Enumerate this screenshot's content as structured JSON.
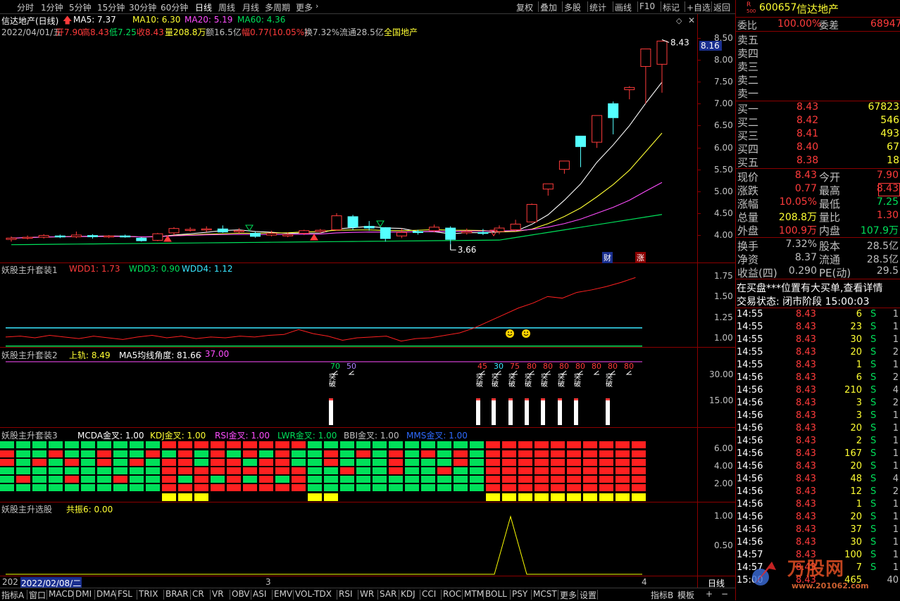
{
  "toolbar": {
    "periods": [
      "分时",
      "1分钟",
      "5分钟",
      "15分钟",
      "30分钟",
      "60分钟",
      "日线",
      "周线",
      "月线",
      "多周期",
      "更多"
    ],
    "active_period": "日线",
    "right_items": [
      "复权",
      "叠加",
      "多股",
      "统计",
      "画线",
      "F10",
      "标记",
      "+自选",
      "返回"
    ]
  },
  "main_chart": {
    "title": "信达地产(日线)",
    "ma5": "MA5: 7.37",
    "ma10": "MA10: 6.30",
    "ma20": "MA20: 5.19",
    "ma60": "MA60: 4.36",
    "info_date": "2022/04/01/五",
    "info_open": "开7.90",
    "info_high": "高8.43",
    "info_low": "低7.25",
    "info_close": "收8.43",
    "info_vol": "量208.8万",
    "info_amt": "额16.5亿",
    "info_pct": "幅0.77(10.05%)",
    "info_turn": "换7.32%",
    "info_float": "流通28.5亿",
    "info_sector": "全国地产",
    "current_price_tag": "8.16",
    "high_label": "8.43",
    "low_label": "3.66",
    "badge_cai": "财",
    "badge_zhang": "涨",
    "y_ticks": [
      "8.50",
      "8.00",
      "7.50",
      "7.00",
      "6.50",
      "6.00",
      "5.50",
      "5.00",
      "4.50",
      "4.00"
    ],
    "candles": [
      {
        "o": 3.9,
        "c": 3.93,
        "h": 3.97,
        "l": 3.85
      },
      {
        "o": 3.94,
        "c": 3.95,
        "h": 3.99,
        "l": 3.9
      },
      {
        "o": 3.95,
        "c": 3.99,
        "h": 4.02,
        "l": 3.92
      },
      {
        "o": 3.98,
        "c": 3.97,
        "h": 4.01,
        "l": 3.93
      },
      {
        "o": 3.96,
        "c": 4.0,
        "h": 4.08,
        "l": 3.93
      },
      {
        "o": 3.99,
        "c": 3.96,
        "h": 4.02,
        "l": 3.92
      },
      {
        "o": 3.96,
        "c": 3.98,
        "h": 4.0,
        "l": 3.93
      },
      {
        "o": 3.98,
        "c": 3.97,
        "h": 4.01,
        "l": 3.94
      },
      {
        "o": 3.93,
        "c": 3.87,
        "h": 3.95,
        "l": 3.85
      },
      {
        "o": 3.88,
        "c": 4.03,
        "h": 4.05,
        "l": 3.86
      },
      {
        "o": 4.05,
        "c": 4.15,
        "h": 4.18,
        "l": 4.0
      },
      {
        "o": 4.12,
        "c": 4.13,
        "h": 4.18,
        "l": 4.08
      },
      {
        "o": 4.12,
        "c": 4.14,
        "h": 4.2,
        "l": 4.07
      },
      {
        "o": 4.14,
        "c": 4.07,
        "h": 4.22,
        "l": 4.05
      },
      {
        "o": 4.09,
        "c": 4.1,
        "h": 4.16,
        "l": 4.04
      },
      {
        "o": 4.04,
        "c": 3.97,
        "h": 4.08,
        "l": 3.94
      },
      {
        "o": 4.0,
        "c": 4.04,
        "h": 4.1,
        "l": 3.97
      },
      {
        "o": 3.98,
        "c": 4.01,
        "h": 4.06,
        "l": 3.95
      },
      {
        "o": 4.04,
        "c": 4.1,
        "h": 4.12,
        "l": 4.0
      },
      {
        "o": 4.08,
        "c": 4.11,
        "h": 4.14,
        "l": 4.04
      },
      {
        "o": 4.12,
        "c": 4.44,
        "h": 4.5,
        "l": 4.1
      },
      {
        "o": 4.42,
        "c": 4.18,
        "h": 4.46,
        "l": 4.12
      },
      {
        "o": 4.2,
        "c": 4.16,
        "h": 4.32,
        "l": 4.1
      },
      {
        "o": 4.17,
        "c": 3.92,
        "h": 4.18,
        "l": 3.85
      },
      {
        "o": 3.98,
        "c": 4.06,
        "h": 4.15,
        "l": 3.93
      },
      {
        "o": 4.08,
        "c": 4.07,
        "h": 4.12,
        "l": 4.01
      },
      {
        "o": 4.1,
        "c": 4.18,
        "h": 4.24,
        "l": 4.06
      },
      {
        "o": 4.16,
        "c": 3.9,
        "h": 4.2,
        "l": 3.66
      },
      {
        "o": 4.05,
        "c": 4.08,
        "h": 4.15,
        "l": 4.01
      },
      {
        "o": 4.06,
        "c": 4.04,
        "h": 4.14,
        "l": 4.0
      },
      {
        "o": 4.08,
        "c": 4.16,
        "h": 4.22,
        "l": 4.02
      },
      {
        "o": 4.12,
        "c": 4.25,
        "h": 4.35,
        "l": 4.08
      },
      {
        "o": 4.3,
        "c": 4.7,
        "h": 4.72,
        "l": 4.28
      },
      {
        "o": 5.05,
        "c": 5.17,
        "h": 5.17,
        "l": 4.9
      },
      {
        "o": 5.5,
        "c": 5.69,
        "h": 5.69,
        "l": 5.4
      },
      {
        "o": 6.26,
        "c": 6.02,
        "h": 6.26,
        "l": 5.55
      },
      {
        "o": 6.12,
        "c": 6.73,
        "h": 6.73,
        "l": 5.99
      },
      {
        "o": 7.0,
        "c": 6.68,
        "h": 7.05,
        "l": 6.3
      },
      {
        "o": 7.32,
        "c": 7.37,
        "h": 7.4,
        "l": 7.1
      },
      {
        "o": 7.85,
        "c": 8.25,
        "h": 8.25,
        "l": 7.0
      },
      {
        "o": 7.9,
        "c": 8.43,
        "h": 8.43,
        "l": 7.25
      }
    ]
  },
  "panel1": {
    "title": "妖股主升套装1",
    "wdd1": "WDD1: 1.73",
    "wdd3": "WDD3: 0.90",
    "wdd4": "WDD4: 1.12",
    "y_ticks": [
      "1.75",
      "1.50",
      "1.25",
      "1.00"
    ]
  },
  "panel2": {
    "title": "妖股主升套装2",
    "upper": "上轨: 8.49",
    "angle": "MA5均线角度: 81.66",
    "extra": ": 37.00",
    "y_ticks": [
      "30.00",
      "15.00"
    ],
    "top_labels": [
      "70",
      "50",
      "45",
      "30",
      "75",
      "80",
      "80",
      "80",
      "80",
      "80",
      "80",
      "80"
    ],
    "break_label": "突破"
  },
  "panel3": {
    "title": "妖股主升套装3",
    "mcda": "MCDA金叉: 1.00",
    "kdj": "KDJ金叉: 1.00",
    "rsi": "RSI金叉: 1.00",
    "lwr": "LWR金叉: 1.00",
    "bbi": "BBI金叉: 1.00",
    "mms": "MMS金叉: 1.00",
    "y_ticks": [
      "6.00",
      "4.00",
      "2.00"
    ]
  },
  "panel4": {
    "title": "妖股主升选股",
    "resonance": "共振6: 0.00",
    "y_ticks": [
      "1.00",
      "0.50"
    ]
  },
  "timeline": {
    "start_year": "202",
    "cursor_date": "2022/02/08/二",
    "mark3": "3",
    "mark4": "4",
    "period_label": "日线"
  },
  "bottom_tabs": [
    "指标A",
    "窗口",
    "MACD",
    "DMI",
    "DMA",
    "FSL",
    "TRIX",
    "BRAR",
    "CR",
    "VR",
    "OBV",
    "ASI",
    "EMV",
    "VOL-TDX",
    "RSI",
    "WR",
    "SAR",
    "KDJ",
    "CCI",
    "ROC",
    "MTM",
    "BOLL",
    "PSY",
    "MCST",
    "更多",
    "设置"
  ],
  "bottom_right_tabs": [
    "指标B",
    "模板"
  ],
  "quote": {
    "code": "600657",
    "name": "信达地产",
    "r_label": "R",
    "r_num": "500",
    "weibi_label": "委比",
    "weibi_value": "100.00%",
    "weicha_label": "委差",
    "weicha_value": "68947",
    "asks": [
      "卖五",
      "卖四",
      "卖三",
      "卖二",
      "卖一"
    ],
    "bids": [
      {
        "label": "买一",
        "price": "8.43",
        "vol": "67823"
      },
      {
        "label": "买二",
        "price": "8.42",
        "vol": "546"
      },
      {
        "label": "买三",
        "price": "8.41",
        "vol": "493"
      },
      {
        "label": "买四",
        "price": "8.40",
        "vol": "67"
      },
      {
        "label": "买五",
        "price": "8.38",
        "vol": "18"
      }
    ],
    "stats": [
      {
        "l1": "现价",
        "v1": "8.43",
        "l2": "今开",
        "v2": "7.90",
        "c1": "red",
        "c2": "red"
      },
      {
        "l1": "涨跌",
        "v1": "0.77",
        "l2": "最高",
        "v2": "8.43",
        "c1": "red",
        "c2": "red"
      },
      {
        "l1": "涨幅",
        "v1": "10.05%",
        "l2": "最低",
        "v2": "7.25",
        "c1": "red",
        "c2": "green"
      },
      {
        "l1": "总量",
        "v1": "208.8万",
        "l2": "量比",
        "v2": "1.30",
        "c1": "yellow",
        "c2": "red"
      },
      {
        "l1": "外盘",
        "v1": "100.9万",
        "l2": "内盘",
        "v2": "107.9万",
        "c1": "red",
        "c2": "green"
      }
    ],
    "stats2": [
      {
        "l1": "换手",
        "v1": "7.32%",
        "l2": "股本",
        "v2": "28.5亿"
      },
      {
        "l1": "净资",
        "v1": "8.37",
        "l2": "流通",
        "v2": "28.5亿"
      },
      {
        "l1": "收益(四)",
        "v1": "0.290",
        "l2": "PE(动)",
        "v2": "29.5"
      }
    ],
    "notice": "在买盘***位置有大买单,查看详情",
    "trade_state": "交易状态: 闭市阶段 15:00:03",
    "ticks": [
      {
        "t": "14:55",
        "p": "8.43",
        "v": "6",
        "s": "S",
        "n": "1"
      },
      {
        "t": "14:55",
        "p": "8.43",
        "v": "23",
        "s": "S",
        "n": "1"
      },
      {
        "t": "14:55",
        "p": "8.43",
        "v": "30",
        "s": "S",
        "n": "1"
      },
      {
        "t": "14:55",
        "p": "8.43",
        "v": "20",
        "s": "S",
        "n": "2"
      },
      {
        "t": "14:55",
        "p": "8.43",
        "v": "1",
        "s": "S",
        "n": "1"
      },
      {
        "t": "14:56",
        "p": "8.43",
        "v": "6",
        "s": "S",
        "n": "2"
      },
      {
        "t": "14:56",
        "p": "8.43",
        "v": "210",
        "s": "S",
        "n": "4"
      },
      {
        "t": "14:56",
        "p": "8.43",
        "v": "3",
        "s": "S",
        "n": "2"
      },
      {
        "t": "14:56",
        "p": "8.43",
        "v": "3",
        "s": "S",
        "n": "1"
      },
      {
        "t": "14:56",
        "p": "8.43",
        "v": "20",
        "s": "S",
        "n": "1"
      },
      {
        "t": "14:56",
        "p": "8.43",
        "v": "2",
        "s": "S",
        "n": "1"
      },
      {
        "t": "14:56",
        "p": "8.43",
        "v": "167",
        "s": "S",
        "n": "1"
      },
      {
        "t": "14:56",
        "p": "8.43",
        "v": "20",
        "s": "S",
        "n": "1"
      },
      {
        "t": "14:56",
        "p": "8.43",
        "v": "48",
        "s": "S",
        "n": "4"
      },
      {
        "t": "14:56",
        "p": "8.43",
        "v": "12",
        "s": "S",
        "n": "2"
      },
      {
        "t": "14:56",
        "p": "8.43",
        "v": "1",
        "s": "S",
        "n": "1"
      },
      {
        "t": "14:56",
        "p": "8.43",
        "v": "20",
        "s": "S",
        "n": "1"
      },
      {
        "t": "14:56",
        "p": "8.43",
        "v": "37",
        "s": "S",
        "n": "1"
      },
      {
        "t": "14:56",
        "p": "8.43",
        "v": "30",
        "s": "S",
        "n": "1"
      },
      {
        "t": "14:57",
        "p": "8.43",
        "v": "100",
        "s": "S",
        "n": "1"
      },
      {
        "t": "14:57",
        "p": "8.43",
        "v": "7",
        "s": "S",
        "n": "1"
      },
      {
        "t": "15:00",
        "p": "8.43",
        "v": "465",
        "s": "",
        "n": "40"
      }
    ],
    "watermark_brand": "万股网",
    "watermark_url": "www.201062.com"
  }
}
